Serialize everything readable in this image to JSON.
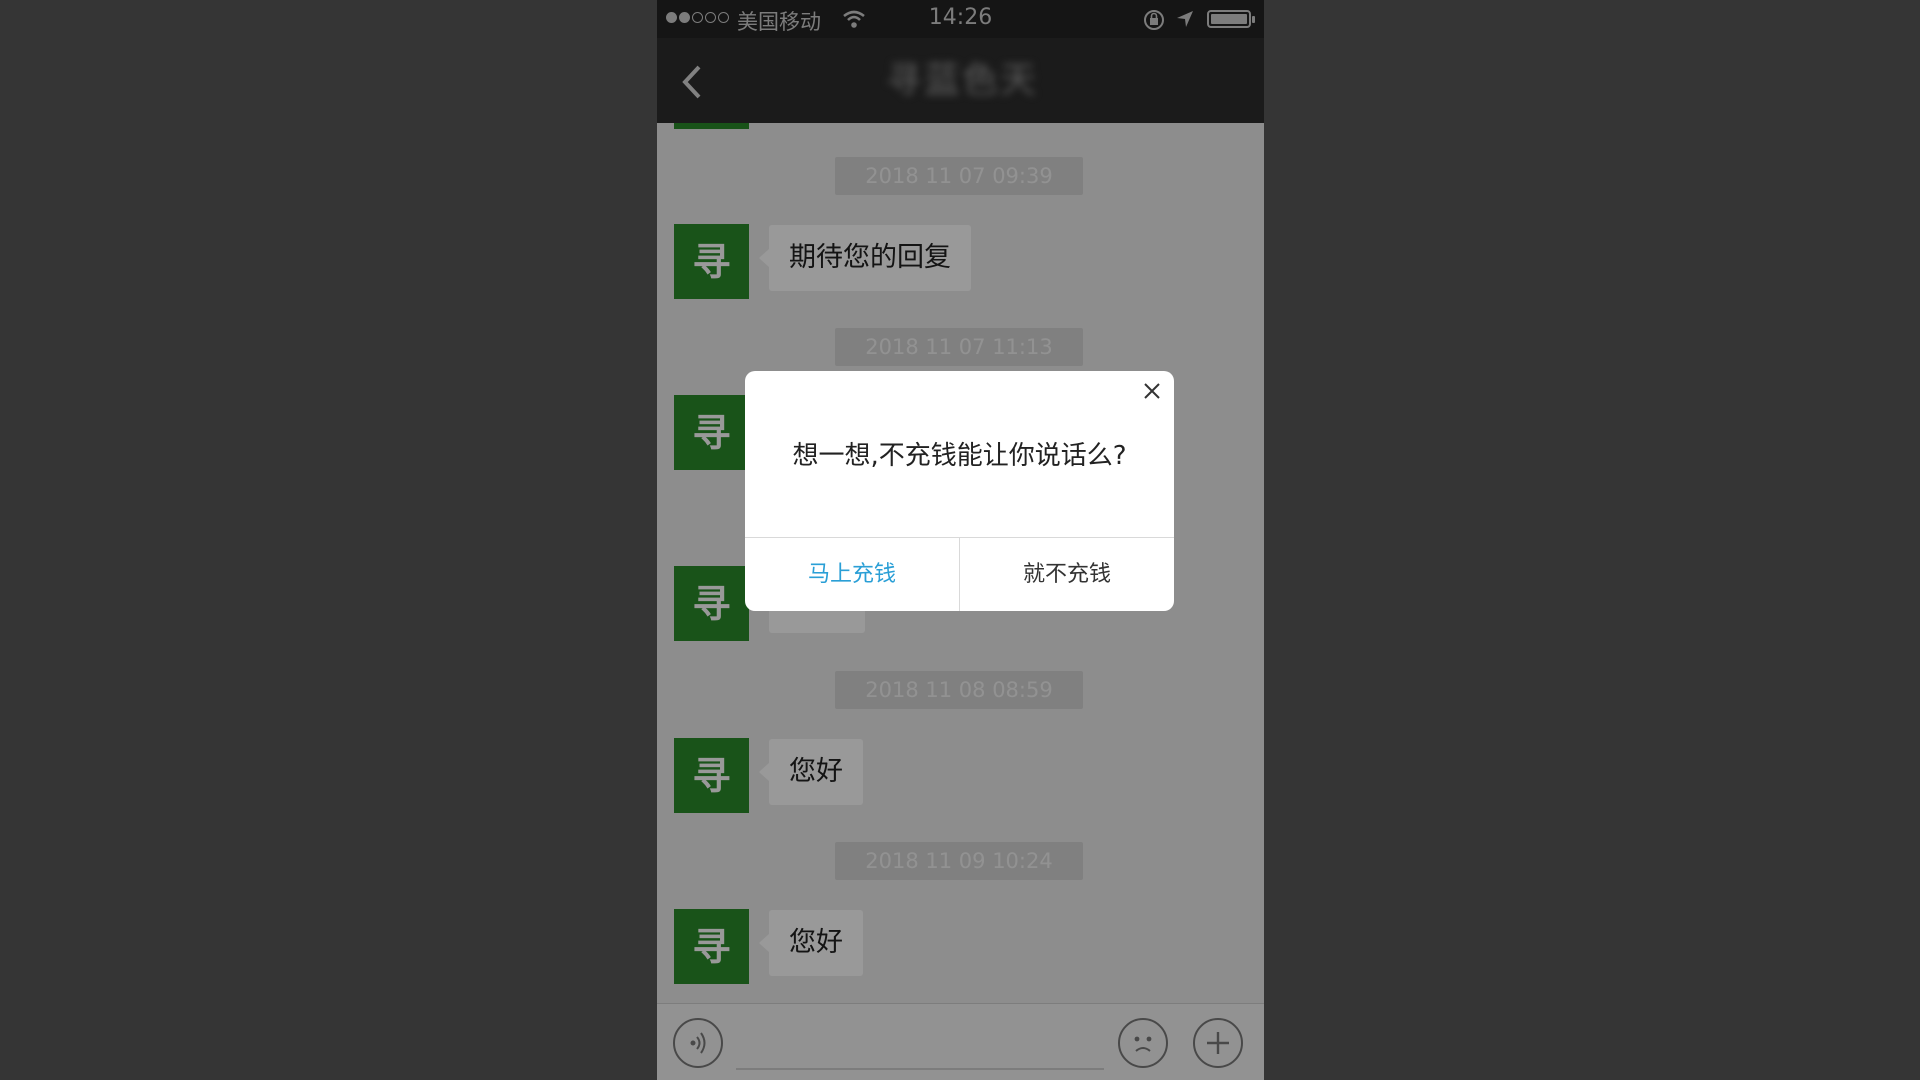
{
  "status_bar": {
    "carrier": "美国移动",
    "time": "14:26",
    "icons": [
      "signal-dots-icon",
      "wifi-icon",
      "rotation-lock-icon",
      "location-arrow-icon",
      "battery-icon"
    ]
  },
  "nav": {
    "back_icon": "chevron-left-icon",
    "title": "寻蓝色天"
  },
  "messages": [
    {
      "timestamp": "2018 11 07 09:39",
      "avatar": "寻",
      "text": "期待您的回复"
    },
    {
      "timestamp": "2018 11 07 11:13",
      "avatar": "寻",
      "text": ""
    },
    {
      "timestamp": "",
      "avatar": "寻",
      "text": ""
    },
    {
      "timestamp": "2018 11 08 08:59",
      "avatar": "寻",
      "text": "您好"
    },
    {
      "timestamp": "2018 11 09 10:24",
      "avatar": "寻",
      "text": "您好"
    }
  ],
  "input_bar": {
    "icons": [
      "voice-icon",
      "emoji-icon",
      "plus-icon"
    ]
  },
  "dialog": {
    "message": "想一想,不充钱能让你说话么?",
    "primary_label": "马上充钱",
    "secondary_label": "就不充钱",
    "close_icon": "close-icon"
  },
  "colors": {
    "avatar_green": "#2a8a2a",
    "primary_action": "#2a9fd6",
    "background": "#353535"
  }
}
